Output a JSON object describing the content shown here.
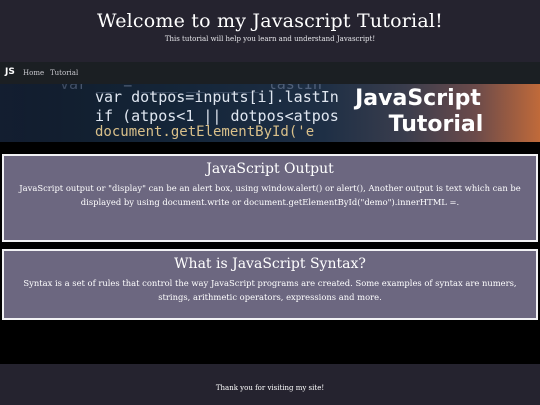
{
  "header": {
    "title": "Welcome to my Javascript Tutorial!",
    "subtitle": "This tutorial will help you learn and understand Javascript!"
  },
  "nav": {
    "brand": "JS",
    "links": [
      "Home",
      "Tutorial"
    ]
  },
  "banner": {
    "code_lines": [
      "var __ = ____ __ _____ lastIn",
      "var dotpos=inputs[i].lastIn",
      "if (atpos<1 || dotpos<atpos",
      "document.getElementById('e"
    ],
    "heading_line1": "JavaScript",
    "heading_line2": "Tutorial"
  },
  "sections": [
    {
      "title": "JavaScript Output",
      "text": "JavaScript output or \"display\" can be an alert box, using window.alert() or alert(), Another output is text which can be displayed by using document.write or document.getElementById(\"demo\").innerHTML =."
    },
    {
      "title": "What is JavaScript Syntax?",
      "text": "Syntax is a set of rules that control the way JavaScript programs are created. Some examples of syntax are numers, strings, arithmetic operators, expressions and more."
    }
  ],
  "footer": {
    "text": "Thank you for visiting my site!"
  },
  "colors": {
    "header_bg": "#25232f",
    "nav_bg": "#1b1f23",
    "card_bg": "#6c6780",
    "page_bg": "#000000"
  }
}
